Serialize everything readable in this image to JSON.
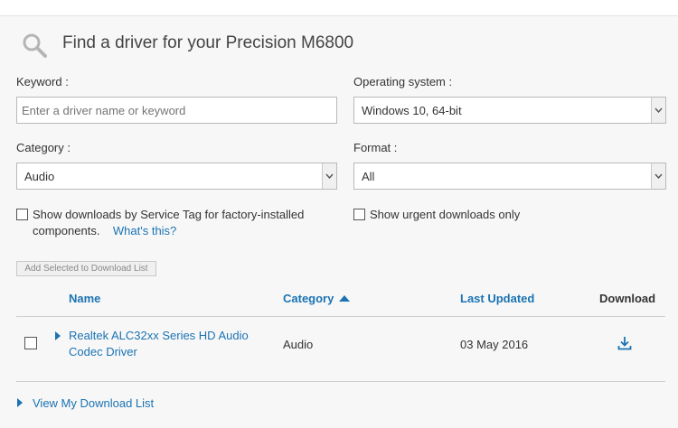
{
  "title": "Find a driver for your Precision M6800",
  "keyword": {
    "label": "Keyword :",
    "placeholder": "Enter a driver name or keyword"
  },
  "os": {
    "label": "Operating system :",
    "value": "Windows 10, 64-bit"
  },
  "category": {
    "label": "Category :",
    "value": "Audio"
  },
  "format": {
    "label": "Format :",
    "value": "All"
  },
  "service_tag": {
    "line1": "Show downloads by Service Tag for factory-installed",
    "line2": "components.",
    "link": "What's this?"
  },
  "urgent": {
    "label": "Show urgent downloads only"
  },
  "add_button": "Add Selected to Download List",
  "table": {
    "headers": {
      "name": "Name",
      "category": "Category",
      "last_updated": "Last Updated",
      "download": "Download"
    },
    "rows": [
      {
        "name_line1": "Realtek ALC32xx Series HD Audio",
        "name_line2": "Codec Driver",
        "category": "Audio",
        "updated": "03 May 2016"
      }
    ]
  },
  "footer_link": "View My Download List",
  "colors": {
    "link": "#1b73b3",
    "panel": "#f7f7f7",
    "border": "#b9b9b9"
  }
}
